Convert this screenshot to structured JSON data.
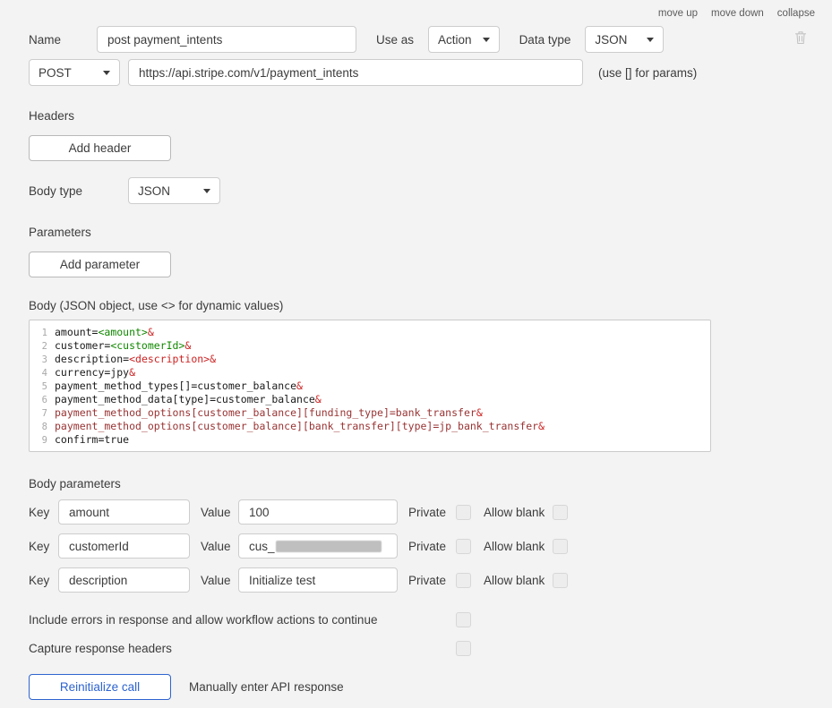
{
  "toolbar": {
    "items": [
      "move up",
      "move down",
      "collapse"
    ]
  },
  "call": {
    "name_label": "Name",
    "name_value": "post payment_intents",
    "use_as_label": "Use as",
    "use_as_value": "Action",
    "data_type_label": "Data type",
    "data_type_value": "JSON",
    "method": "POST",
    "url": "https://api.stripe.com/v1/payment_intents",
    "params_hint": "(use [] for params)"
  },
  "headers_section": {
    "label": "Headers",
    "add_button": "Add header"
  },
  "body_type": {
    "label": "Body type",
    "value": "JSON"
  },
  "parameters_section": {
    "label": "Parameters",
    "add_button": "Add parameter"
  },
  "body_section": {
    "label": "Body (JSON object, use <> for dynamic values)",
    "colors": {
      "plain": "#1a1a1a",
      "tag_green": "#118800",
      "red": "#cc2222",
      "maroon": "#993333",
      "line_number": "#a8a8a8"
    },
    "lines": [
      [
        {
          "t": "amount=",
          "c": "p"
        },
        {
          "t": "<amount>",
          "c": "g"
        },
        {
          "t": "&",
          "c": "r"
        }
      ],
      [
        {
          "t": "customer=",
          "c": "p"
        },
        {
          "t": "<customerId>",
          "c": "g"
        },
        {
          "t": "&",
          "c": "r"
        }
      ],
      [
        {
          "t": "description=",
          "c": "p"
        },
        {
          "t": "<description>",
          "c": "r"
        },
        {
          "t": "&",
          "c": "r"
        }
      ],
      [
        {
          "t": "currency=jpy",
          "c": "p"
        },
        {
          "t": "&",
          "c": "r"
        }
      ],
      [
        {
          "t": "payment_method_types[]=customer_balance",
          "c": "p"
        },
        {
          "t": "&",
          "c": "r"
        }
      ],
      [
        {
          "t": "payment_method_data[type]=customer_balance",
          "c": "p"
        },
        {
          "t": "&",
          "c": "r"
        }
      ],
      [
        {
          "t": "payment_method_options[customer_balance][funding_type]=bank_transfer",
          "c": "m"
        },
        {
          "t": "&",
          "c": "r"
        }
      ],
      [
        {
          "t": "payment_method_options[customer_balance][bank_transfer][type]=jp_bank_transfer",
          "c": "m"
        },
        {
          "t": "&",
          "c": "r"
        }
      ],
      [
        {
          "t": "confirm=true",
          "c": "p"
        }
      ]
    ]
  },
  "body_parameters": {
    "label": "Body parameters",
    "key_label": "Key",
    "value_label": "Value",
    "private_label": "Private",
    "allow_blank_label": "Allow blank",
    "rows": [
      {
        "key": "amount",
        "value": "100",
        "redacted": false
      },
      {
        "key": "customerId",
        "value_prefix": "cus_",
        "redacted": true
      },
      {
        "key": "description",
        "value": "Initialize test",
        "redacted": false
      }
    ]
  },
  "options": {
    "include_errors_label": "Include errors in response and allow workflow actions to continue",
    "capture_headers_label": "Capture response headers"
  },
  "footer": {
    "reinitialize_button": "Reinitialize call",
    "manual_response_label": "Manually enter API response",
    "accent_color": "#2d63cf"
  }
}
